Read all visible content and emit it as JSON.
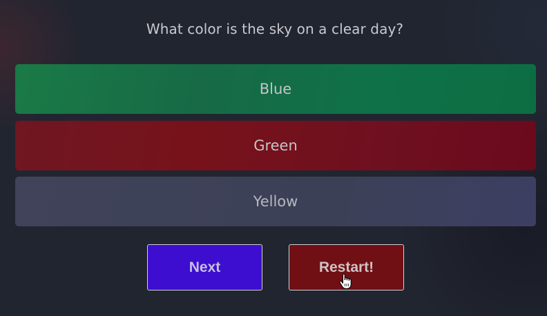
{
  "quiz": {
    "question": "What color is the sky on a clear day?",
    "answers": [
      {
        "label": "Blue",
        "state": "correct",
        "color": "#176a45"
      },
      {
        "label": "Green",
        "state": "incorrect",
        "color": "#77121a"
      },
      {
        "label": "Yellow",
        "state": "neutral",
        "color": "#3c4056"
      }
    ]
  },
  "controls": {
    "next_label": "Next",
    "next_color": "#3d0ecf",
    "restart_label": "Restart!",
    "restart_color": "#701014"
  },
  "cursor": {
    "icon": "hand-pointer-icon"
  }
}
